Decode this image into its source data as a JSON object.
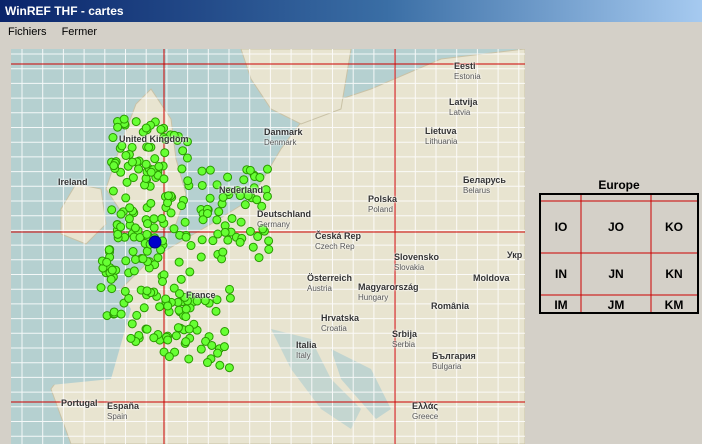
{
  "window": {
    "title": "WinREF THF - cartes"
  },
  "menu": {
    "items": [
      "Fichiers",
      "Fermer"
    ]
  },
  "map": {
    "countries": [
      {
        "name": "Eesti",
        "sub": "Estonia"
      },
      {
        "name": "Latvija",
        "sub": "Latvia"
      },
      {
        "name": "Lietuva",
        "sub": "Lithuania"
      },
      {
        "name": "Danmark",
        "sub": "Denmark"
      },
      {
        "name": "United Kingdom",
        "sub": ""
      },
      {
        "name": "Ireland",
        "sub": ""
      },
      {
        "name": "Nederland",
        "sub": ""
      },
      {
        "name": "Deutschland",
        "sub": "Germany"
      },
      {
        "name": "Polska",
        "sub": "Poland"
      },
      {
        "name": "Беларусь",
        "sub": "Belarus"
      },
      {
        "name": "Česká Rep",
        "sub": "Czech Rep"
      },
      {
        "name": "Slovensko",
        "sub": "Slovakia"
      },
      {
        "name": "Укр",
        "sub": ""
      },
      {
        "name": "Österreich",
        "sub": "Austria"
      },
      {
        "name": "Magyarország",
        "sub": "Hungary"
      },
      {
        "name": "Moldova",
        "sub": ""
      },
      {
        "name": "France",
        "sub": ""
      },
      {
        "name": "Hrvatska",
        "sub": "Croatia"
      },
      {
        "name": "România",
        "sub": ""
      },
      {
        "name": "Srbija",
        "sub": "Serbia"
      },
      {
        "name": "Italia",
        "sub": "Italy"
      },
      {
        "name": "България",
        "sub": "Bulgaria"
      },
      {
        "name": "Portugal",
        "sub": ""
      },
      {
        "name": "España",
        "sub": "Spain"
      },
      {
        "name": "Ελλάς",
        "sub": "Greece"
      }
    ],
    "colors": {
      "sea": "#b5d0d0",
      "land": "#e8e4d0",
      "station": "#66ff33",
      "station_stroke": "#2a9a00",
      "own_qth": "#0000cc",
      "major_grid": "#cc0000",
      "minor_grid": "#ffffff"
    }
  },
  "locator": {
    "title": "Europe",
    "rows": [
      [
        "IO",
        "JO",
        "KO"
      ],
      [
        "IN",
        "JN",
        "KN"
      ],
      [
        "IM",
        "JM",
        "KM"
      ]
    ]
  }
}
